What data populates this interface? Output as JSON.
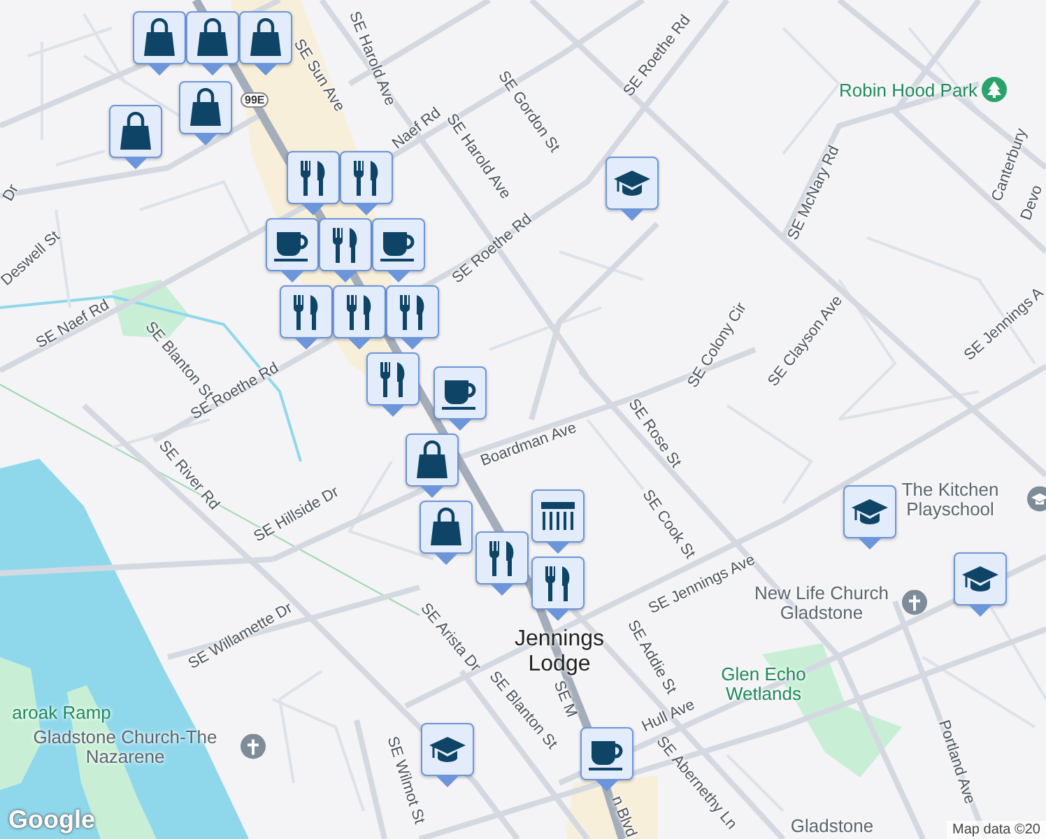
{
  "map": {
    "street_labels": [
      "SE Harold Ave",
      "SE Sun Ave",
      "SE Roethe Rd",
      "SE Gordon St",
      "Naef Rd",
      "SE Harold Ave",
      "SE Roethe Rd",
      "SE McNary Rd",
      "Canterbury",
      "Devo",
      "SE Jennings A",
      "SE Colony Cir",
      "SE Clayson Ave",
      "Deswell St",
      "SE Naef Rd",
      "SE Blanton St",
      "SE Roethe Rd",
      "Boardman Ave",
      "SE Rose St",
      "SE River Rd",
      "SE Hillside Dr",
      "SE Cook St",
      "SE Jennings Ave",
      "SE Arista Dr",
      "SE Willamette Dr",
      "SE Addie St",
      "Hull Ave",
      "SE Blanton St",
      "SE Wilmot St",
      "SE Abernethy Ln",
      "Portland Ave",
      "SE M",
      "n Blvd",
      "Dr"
    ],
    "route_shield": "99E",
    "place_labels": [
      {
        "text": "Robin Hood Park",
        "kind": "park"
      },
      {
        "text": "The Kitchen Playschool",
        "kind": "school"
      },
      {
        "text": "New Life Church Gladstone",
        "kind": "church"
      },
      {
        "text": "Glen Echo Wetlands",
        "kind": "area"
      },
      {
        "text": "Jennings Lodge",
        "kind": "locality"
      },
      {
        "text": "aroak Ramp",
        "kind": "area"
      },
      {
        "text": "Gladstone Church-The Nazarene",
        "kind": "church"
      },
      {
        "text": "Gladstone",
        "kind": "place"
      }
    ],
    "markers": [
      {
        "kind": "shopping"
      },
      {
        "kind": "shopping"
      },
      {
        "kind": "shopping"
      },
      {
        "kind": "shopping"
      },
      {
        "kind": "shopping"
      },
      {
        "kind": "restaurant"
      },
      {
        "kind": "restaurant"
      },
      {
        "kind": "cafe"
      },
      {
        "kind": "restaurant"
      },
      {
        "kind": "cafe"
      },
      {
        "kind": "restaurant"
      },
      {
        "kind": "restaurant"
      },
      {
        "kind": "restaurant"
      },
      {
        "kind": "cafe"
      },
      {
        "kind": "shopping"
      },
      {
        "kind": "shopping"
      },
      {
        "kind": "store"
      },
      {
        "kind": "restaurant"
      },
      {
        "kind": "restaurant"
      },
      {
        "kind": "restaurant"
      },
      {
        "kind": "school"
      },
      {
        "kind": "school"
      },
      {
        "kind": "school"
      },
      {
        "kind": "school"
      },
      {
        "kind": "cafe"
      }
    ],
    "logo": "Google",
    "attribution": "Map data ©20"
  }
}
